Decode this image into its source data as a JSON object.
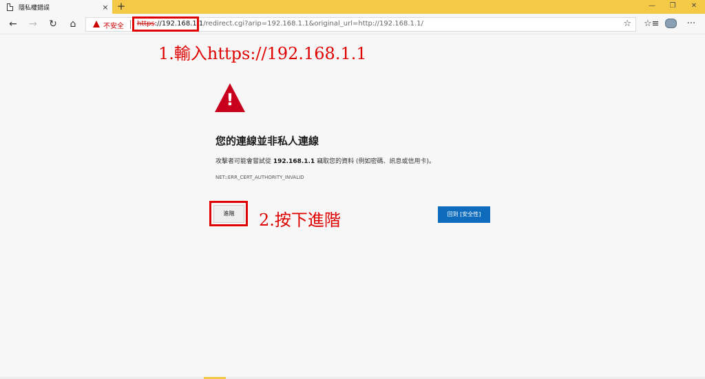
{
  "tab": {
    "title": "隱私權錯誤",
    "close": "×",
    "new_tab": "+"
  },
  "window": {
    "minimize": "—",
    "maximize": "❐",
    "close": "✕"
  },
  "nav": {
    "back": "←",
    "forward": "→",
    "refresh": "↻",
    "home": "⌂"
  },
  "address": {
    "security_label": "不安全",
    "protocol": "https",
    "host_part": "://192.168.1.1",
    "rest": "/redirect.cgi?arip=192.168.1.1&original_url=http://192.168.1.1/",
    "favorite_star": "☆"
  },
  "toolbar": {
    "favorites": "☆≡",
    "more": "···"
  },
  "page": {
    "heading": "您的連線並非私人連線",
    "desc_prefix": "攻擊者可能會嘗試從 ",
    "desc_host": "192.168.1.1",
    "desc_suffix": " 竊取您的資料 (例如密碼、訊息或信用卡)。",
    "error_code": "NET::ERR_CERT_AUTHORITY_INVALID",
    "advanced_button": "進階",
    "back_button": "回到 [安全性]"
  },
  "annotations": {
    "step1": "1.輸入https://192.168.1.1",
    "step2": "2.按下進階"
  },
  "colors": {
    "accent": "#f5c948",
    "danger": "#c8001e",
    "primary": "#0f6cbd",
    "annotation": "#e00000"
  }
}
